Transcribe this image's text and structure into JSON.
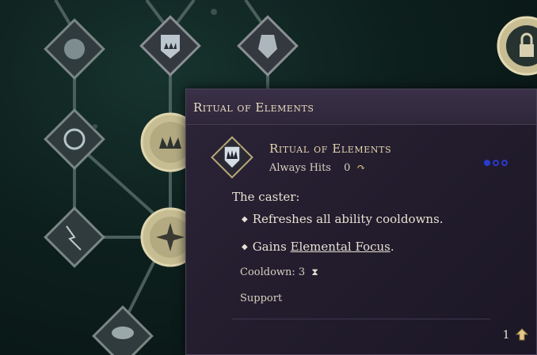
{
  "tooltip": {
    "header_title": "Ritual of Elements",
    "ability": {
      "name": "Ritual of Elements",
      "accuracy": "Always Hits",
      "recovery": "0",
      "recovery_icon": "refresh-arrow-icon",
      "icon": "crown-shield-icon",
      "pips": {
        "filled": 1,
        "total": 3,
        "color": "#2a3bd0"
      }
    },
    "description": {
      "intro": "The caster:",
      "bullets": [
        {
          "text": "Refreshes all ability cooldowns."
        },
        {
          "prefix": "Gains ",
          "link": "Elemental Focus",
          "suffix": "."
        }
      ]
    },
    "cooldown_label": "Cooldown: 3",
    "cooldown_icon": "hourglass-icon",
    "category": "Support",
    "cost": "1",
    "cost_icon": "upgrade-point-icon"
  },
  "colors": {
    "title": "#e9dcc0",
    "text": "#e8e1d3",
    "panel": "#2c2538",
    "accent_gold": "#c9b98a"
  }
}
